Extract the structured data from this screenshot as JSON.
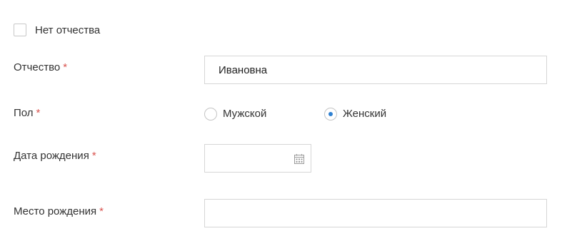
{
  "no_patronymic": {
    "label": "Нет отчества",
    "checked": false
  },
  "patronymic": {
    "label": "Отчество",
    "required_mark": "*",
    "value": "Ивановна"
  },
  "gender": {
    "label": "Пол",
    "required_mark": "*",
    "options": [
      {
        "label": "Мужской",
        "selected": false
      },
      {
        "label": "Женский",
        "selected": true
      }
    ]
  },
  "birth_date": {
    "label": "Дата рождения",
    "required_mark": "*",
    "value": "",
    "icon": "calendar-icon"
  },
  "birth_place": {
    "label": "Место рождения",
    "required_mark": "*",
    "value": ""
  },
  "colors": {
    "required": "#d9534f",
    "radio_selected": "#2f80d1",
    "border": "#d6d6d6"
  }
}
